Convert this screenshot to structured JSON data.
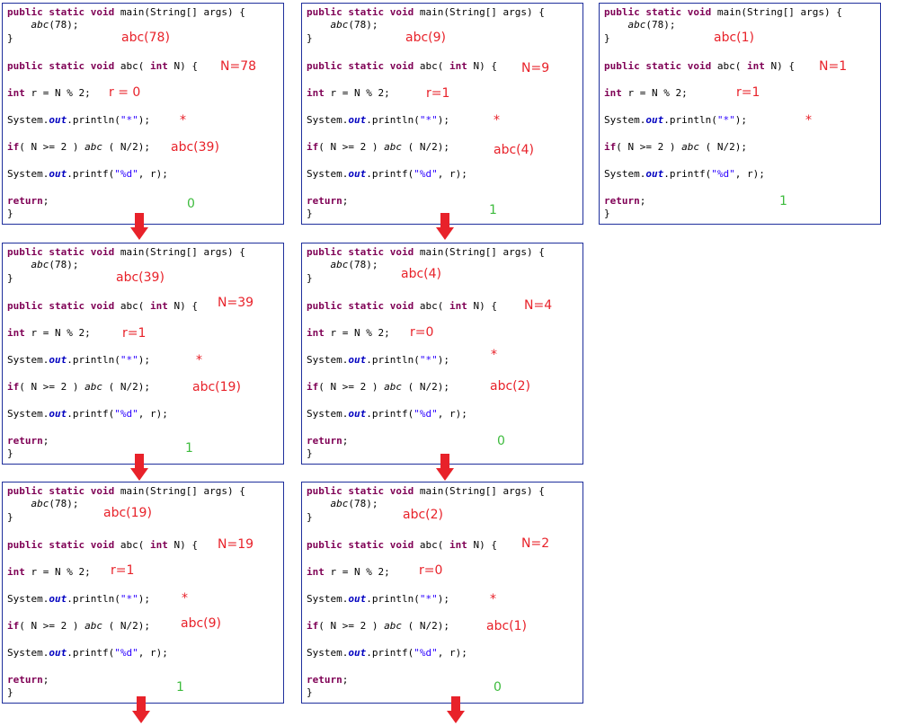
{
  "colors": {
    "border": "#1f2f9c",
    "annotation": "#e8222a",
    "return_value": "#3dbb3d",
    "arrow": "#e8222a",
    "keyword": "#7f0055",
    "field": "#0000c0",
    "string": "#2a00ff"
  },
  "code": {
    "kw_public_static_void": "public static void",
    "main_sig": " main(String[] args) {",
    "abc_call_main": "abc",
    "main_args": "(78);",
    "close_brace": "}",
    "abc_sig_name": " abc( ",
    "kw_int": "int",
    "abc_sig_rest": " N) {",
    "mod_stmt": " r = N % 2;",
    "println_pre": "System.",
    "out": "out",
    "println_mid": ".println(",
    "println_str": "\"*\"",
    "println_end": ");",
    "kw_if": "if",
    "if_mid": "( N >= 2 ) ",
    "abc_call_if": "abc",
    "if_end": " ( N/2);",
    "printf_mid": ".printf(",
    "printf_str": "\"%d\"",
    "printf_end": ", r);",
    "kw_return": "return",
    "semicolon": ";"
  },
  "panels": [
    {
      "call": "abc(78)",
      "n": "N=78",
      "r": "r = 0",
      "star": "*",
      "recurse": "abc(39)",
      "result": "0"
    },
    {
      "call": "abc(9)",
      "n": "N=9",
      "r": "r=1",
      "star": "*",
      "recurse": "abc(4)",
      "result": "1"
    },
    {
      "call": "abc(1)",
      "n": "N=1",
      "r": "r=1",
      "star": "*",
      "recurse": "",
      "result": "1"
    },
    {
      "call": "abc(39)",
      "n": "N=39",
      "r": "r=1",
      "star": "*",
      "recurse": "abc(19)",
      "result": "1"
    },
    {
      "call": "abc(4)",
      "n": "N=4",
      "r": "r=0",
      "star": "*",
      "recurse": "abc(2)",
      "result": "0"
    },
    {
      "call": "abc(19)",
      "n": "N=19",
      "r": "r=1",
      "star": "*",
      "recurse": "abc(9)",
      "result": "1"
    },
    {
      "call": "abc(2)",
      "n": "N=2",
      "r": "r=0",
      "star": "*",
      "recurse": "abc(1)",
      "result": "0"
    }
  ]
}
